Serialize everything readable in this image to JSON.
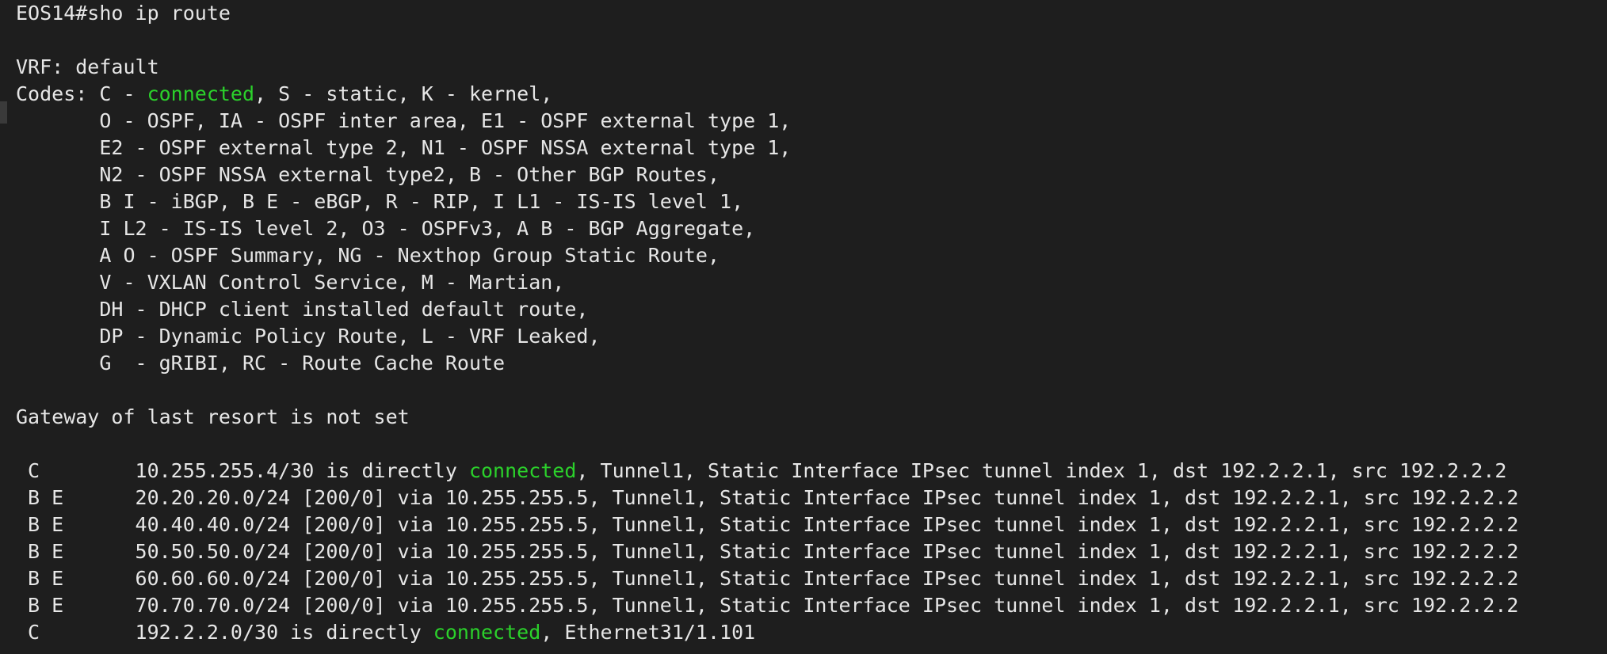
{
  "terminal": {
    "prompt": "EOS14#sho ip route",
    "vrf_line": "VRF: default",
    "codes": {
      "line1_a": "Codes: C - ",
      "line1_hl": "connected",
      "line1_b": ", S - static, K - kernel,",
      "lines": [
        "       O - OSPF, IA - OSPF inter area, E1 - OSPF external type 1,",
        "       E2 - OSPF external type 2, N1 - OSPF NSSA external type 1,",
        "       N2 - OSPF NSSA external type2, B - Other BGP Routes,",
        "       B I - iBGP, B E - eBGP, R - RIP, I L1 - IS-IS level 1,",
        "       I L2 - IS-IS level 2, O3 - OSPFv3, A B - BGP Aggregate,",
        "       A O - OSPF Summary, NG - Nexthop Group Static Route,",
        "       V - VXLAN Control Service, M - Martian,",
        "       DH - DHCP client installed default route,",
        "       DP - Dynamic Policy Route, L - VRF Leaked,",
        "       G  - gRIBI, RC - Route Cache Route"
      ]
    },
    "gateway_line": "Gateway of last resort is not set",
    "routes": {
      "r1_a": " C        10.255.255.4/30 is directly ",
      "r1_hl": "connected",
      "r1_b": ", Tunnel1, Static Interface IPsec tunnel index 1, dst 192.2.2.1, src 192.2.2.2",
      "bgp": [
        " B E      20.20.20.0/24 [200/0] via 10.255.255.5, Tunnel1, Static Interface IPsec tunnel index 1, dst 192.2.2.1, src 192.2.2.2",
        " B E      40.40.40.0/24 [200/0] via 10.255.255.5, Tunnel1, Static Interface IPsec tunnel index 1, dst 192.2.2.1, src 192.2.2.2",
        " B E      50.50.50.0/24 [200/0] via 10.255.255.5, Tunnel1, Static Interface IPsec tunnel index 1, dst 192.2.2.1, src 192.2.2.2",
        " B E      60.60.60.0/24 [200/0] via 10.255.255.5, Tunnel1, Static Interface IPsec tunnel index 1, dst 192.2.2.1, src 192.2.2.2",
        " B E      70.70.70.0/24 [200/0] via 10.255.255.5, Tunnel1, Static Interface IPsec tunnel index 1, dst 192.2.2.1, src 192.2.2.2"
      ],
      "r7_a": " C        192.2.2.0/30 is directly ",
      "r7_hl": "connected",
      "r7_b": ", Ethernet31/1.101"
    },
    "colors": {
      "background": "#1e1e1e",
      "text": "#e6e6e6",
      "highlight": "#2bd12b"
    }
  }
}
